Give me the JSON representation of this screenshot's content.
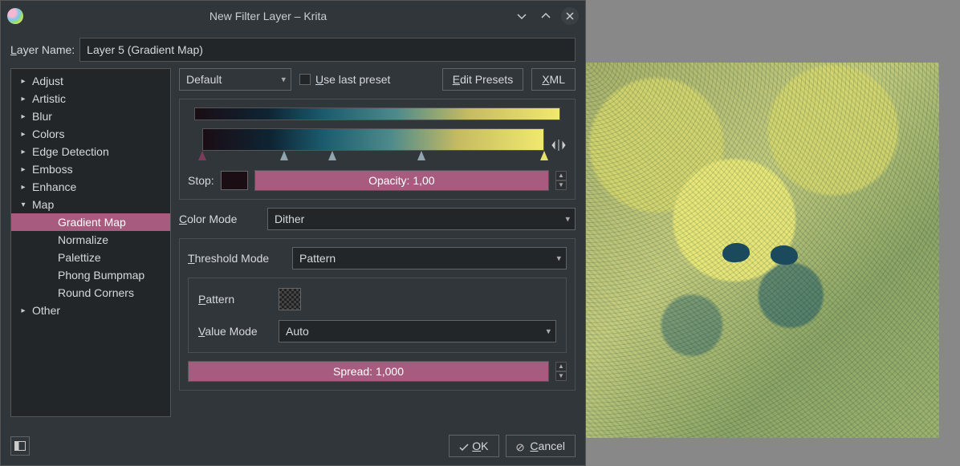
{
  "titlebar": {
    "title": "New Filter Layer – Krita"
  },
  "layer": {
    "label_pre": "L",
    "label_post": "ayer Name:",
    "value": "Layer 5 (Gradient Map)"
  },
  "tree": {
    "items": [
      {
        "label": "Adjust",
        "expandable": true
      },
      {
        "label": "Artistic",
        "expandable": true
      },
      {
        "label": "Blur",
        "expandable": true
      },
      {
        "label": "Colors",
        "expandable": true
      },
      {
        "label": "Edge Detection",
        "expandable": true
      },
      {
        "label": "Emboss",
        "expandable": true
      },
      {
        "label": "Enhance",
        "expandable": true
      },
      {
        "label": "Map",
        "expandable": true,
        "expanded": true,
        "children": [
          {
            "label": "Gradient Map",
            "selected": true
          },
          {
            "label": "Normalize"
          },
          {
            "label": "Palettize"
          },
          {
            "label": "Phong Bumpmap"
          },
          {
            "label": "Round Corners"
          }
        ]
      },
      {
        "label": "Other",
        "expandable": true
      }
    ]
  },
  "config": {
    "preset_value": "Default",
    "use_last_pre": "U",
    "use_last_post": "se last preset",
    "edit_presets_pre": "E",
    "edit_presets_post": "dit Presets",
    "xml_pre": "X",
    "xml_post": "ML",
    "stop_label": "Stop:",
    "opacity_text": "Opacity: 1,00",
    "color_mode_pre": "C",
    "color_mode_post": "olor Mode",
    "color_mode_value": "Dither",
    "threshold_pre": "T",
    "threshold_post": "hreshold Mode",
    "threshold_value": "Pattern",
    "pattern_pre": "P",
    "pattern_post": "attern",
    "value_mode_pre": "V",
    "value_mode_post": "alue Mode",
    "value_mode_value": "Auto",
    "spread_text": "Spread:  1,000",
    "gradient_stops": [
      0,
      24,
      38,
      64,
      100
    ]
  },
  "footer": {
    "ok_pre": "O",
    "ok_post": "K",
    "cancel_pre": "C",
    "cancel_post": "ancel"
  }
}
